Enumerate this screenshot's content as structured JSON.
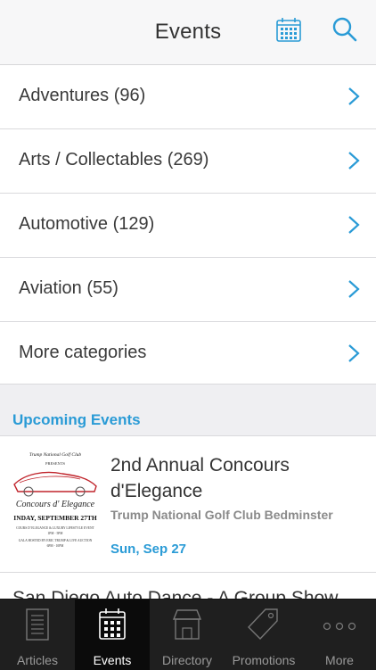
{
  "header": {
    "title": "Events"
  },
  "categories": [
    {
      "label": "Adventures (96)"
    },
    {
      "label": "Arts / Collectables (269)"
    },
    {
      "label": "Automotive (129)"
    },
    {
      "label": "Aviation (55)"
    },
    {
      "label": "More categories"
    }
  ],
  "upcoming": {
    "label": "Upcoming Events"
  },
  "events": [
    {
      "name": "2nd Annual Concours d'Elegance",
      "venue": "Trump National Golf Club Bedminster",
      "date": "Sun, Sep 27",
      "thumb_lines": [
        "Trump National Golf Club",
        "PRESENTS",
        "Concours d' Elegance",
        "INDAY, SEPTEMBER 27TH",
        "COURS D' ELEGANCE & LUXURY LIFESTYLE EVENT",
        "1PM - 5PM",
        "GALA HOSTED BY ERIC TRUMP & LIVE AUCTION",
        "6PM - 10PM"
      ]
    },
    {
      "name": "San Diego Auto Dance - A Group Show"
    }
  ],
  "tabs": [
    {
      "label": "Articles",
      "icon": "articles-icon"
    },
    {
      "label": "Events",
      "icon": "calendar-icon",
      "active": true
    },
    {
      "label": "Directory",
      "icon": "store-icon"
    },
    {
      "label": "Promotions",
      "icon": "tag-icon"
    },
    {
      "label": "More",
      "icon": "more-icon"
    }
  ],
  "colors": {
    "accent": "#2a9bd6",
    "tabbar": "#1f1f1f",
    "section_bg": "#efeff2"
  }
}
